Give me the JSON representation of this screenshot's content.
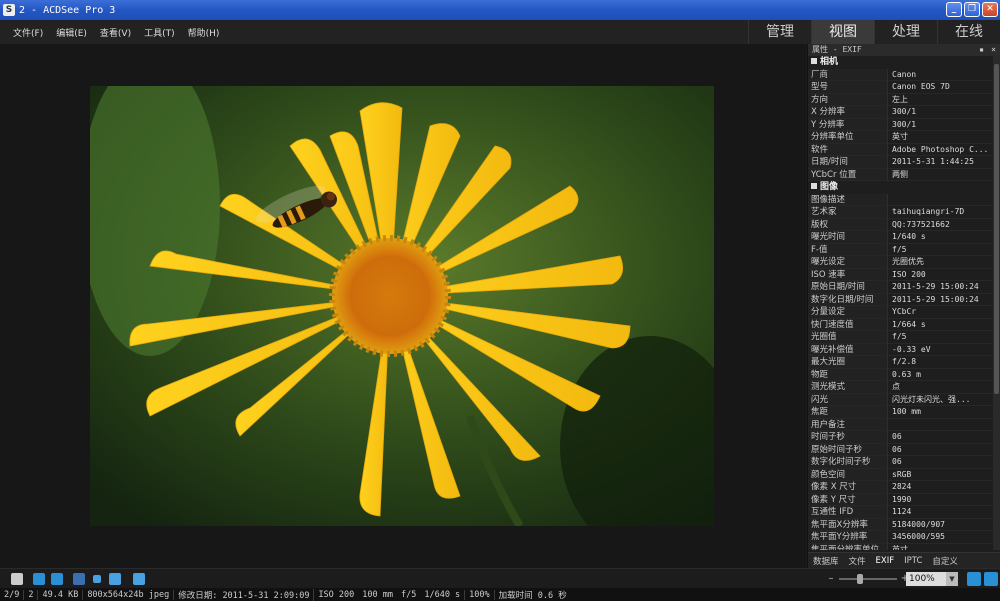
{
  "window": {
    "title": "2 - ACDSee Pro 3",
    "icon_letter": "S"
  },
  "window_buttons": {
    "minimize": "_",
    "maximize": "❐",
    "close": "✕"
  },
  "menu": [
    "文件(F)",
    "编辑(E)",
    "查看(V)",
    "工具(T)",
    "帮助(H)"
  ],
  "modes": [
    {
      "label": "管理",
      "active": false
    },
    {
      "label": "视图",
      "active": true
    },
    {
      "label": "处理",
      "active": false
    },
    {
      "label": "在线",
      "active": false
    }
  ],
  "panel": {
    "title": "属性 - EXIF",
    "pin": "▪",
    "close": "×",
    "sections": [
      {
        "name": "相机",
        "rows": [
          {
            "k": "厂商",
            "v": "Canon"
          },
          {
            "k": "型号",
            "v": "Canon EOS 7D"
          },
          {
            "k": "方向",
            "v": "左上"
          },
          {
            "k": "X 分辨率",
            "v": "300/1"
          },
          {
            "k": "Y 分辨率",
            "v": "300/1"
          },
          {
            "k": "分辨率单位",
            "v": "英寸"
          },
          {
            "k": "软件",
            "v": "Adobe Photoshop C..."
          },
          {
            "k": "日期/时间",
            "v": "2011-5-31 1:44:25"
          },
          {
            "k": "YCbCr 位置",
            "v": "两侧"
          }
        ]
      },
      {
        "name": "图像",
        "rows": [
          {
            "k": "图像描述",
            "v": ""
          },
          {
            "k": "艺术家",
            "v": "taihuqiangri-7D"
          },
          {
            "k": "版权",
            "v": "QQ:737521662"
          },
          {
            "k": "曝光时间",
            "v": "1/640 s"
          },
          {
            "k": "F-值",
            "v": "f/5"
          },
          {
            "k": "曝光设定",
            "v": "光圈优先"
          },
          {
            "k": "ISO 速率",
            "v": "ISO 200"
          },
          {
            "k": "原始日期/时间",
            "v": "2011-5-29 15:00:24"
          },
          {
            "k": "数字化日期/时间",
            "v": "2011-5-29 15:00:24"
          },
          {
            "k": "分量设定",
            "v": "YCbCr"
          },
          {
            "k": "快门速度值",
            "v": "1/664 s"
          },
          {
            "k": "光圈值",
            "v": "f/5"
          },
          {
            "k": "曝光补偿值",
            "v": "-0.33 eV"
          },
          {
            "k": "最大光圈",
            "v": "f/2.8"
          },
          {
            "k": "物距",
            "v": "0.63 m"
          },
          {
            "k": "测光模式",
            "v": "点"
          },
          {
            "k": "闪光",
            "v": "闪光灯未闪光、强..."
          },
          {
            "k": "焦距",
            "v": "100 mm"
          },
          {
            "k": "用户备注",
            "v": ""
          },
          {
            "k": "时间子秒",
            "v": "06"
          },
          {
            "k": "原始时间子秒",
            "v": "06"
          },
          {
            "k": "数字化时间子秒",
            "v": "06"
          },
          {
            "k": "颜色空间",
            "v": "sRGB"
          },
          {
            "k": "像素 X 尺寸",
            "v": "2824"
          },
          {
            "k": "像素 Y 尺寸",
            "v": "1990"
          },
          {
            "k": "互通性 IFD",
            "v": "1124"
          },
          {
            "k": "焦平面X分辨率",
            "v": "5184000/907"
          },
          {
            "k": "焦平面Y分辨率",
            "v": "3456000/595"
          },
          {
            "k": "焦平面分辨率单位",
            "v": "英寸"
          }
        ]
      }
    ],
    "tabs": [
      {
        "label": "数据库",
        "active": false
      },
      {
        "label": "文件",
        "active": false
      },
      {
        "label": "EXIF",
        "active": true
      },
      {
        "label": "IPTC",
        "active": false
      },
      {
        "label": "自定义",
        "active": false
      }
    ]
  },
  "toolbar": {
    "zoom_minus": "–",
    "zoom_plus": "+",
    "zoom_value": "100%",
    "zoom_drop": "▼"
  },
  "status": {
    "index": "2/9",
    "count": "2",
    "size": "49.4 KB",
    "dims": "800x564x24b jpeg",
    "modified": "修改日期: 2011-5-31 2:09:09",
    "iso": "ISO 200",
    "focal": "100 mm",
    "aperture": "f/5",
    "shutter": "1/640 s",
    "zoom": "100%",
    "load": "加载时间 0.6 秒"
  },
  "colors": {
    "titlebar": "#2457c4",
    "accent": "#2a8fd4",
    "petal": "#f5c21a",
    "background": "#1b1b1b"
  }
}
